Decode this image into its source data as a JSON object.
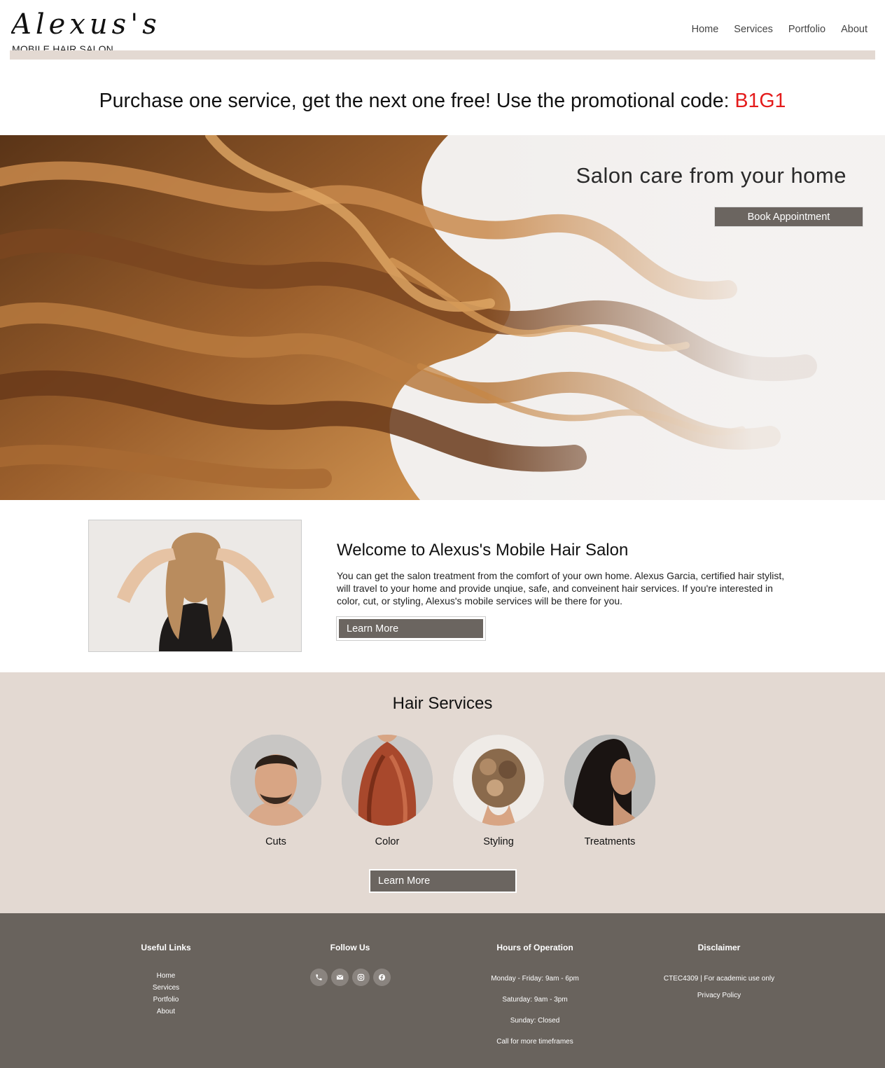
{
  "header": {
    "logo_script": "Alexus's",
    "logo_subtitle": "MOBILE HAIR SALON",
    "nav": [
      "Home",
      "Services",
      "Portfolio",
      "About"
    ]
  },
  "promo": {
    "text": "Purchase one service, get the next one free! Use the promotional code: ",
    "code": "B1G1",
    "code_color": "#e41b1b"
  },
  "hero": {
    "title": "Salon care from your home",
    "button": "Book Appointment"
  },
  "welcome": {
    "title": "Welcome to Alexus's Mobile Hair Salon",
    "body": "You can get the salon treatment from the comfort of your own home. Alexus Garcia, certified hair stylist, will travel to your home and provide unqiue, safe, and conveinent hair services. If you're interested in color, cut, or styling, Alexus's mobile services will be there for you.",
    "button": "Learn More"
  },
  "services": {
    "title": "Hair Services",
    "items": [
      "Cuts",
      "Color",
      "Styling",
      "Treatments"
    ],
    "button": "Learn More",
    "background": "#e3d9d2"
  },
  "footer": {
    "background": "#69635d",
    "useful_links": {
      "title": "Useful Links",
      "items": [
        "Home",
        "Services",
        "Portfolio",
        "About"
      ]
    },
    "follow_us": {
      "title": "Follow Us",
      "icons": [
        "phone-icon",
        "email-icon",
        "instagram-icon",
        "facebook-icon"
      ]
    },
    "hours": {
      "title": "Hours of Operation",
      "lines": [
        "Monday - Friday: 9am - 6pm",
        "Saturday: 9am - 3pm",
        "Sunday: Closed",
        "Call for more timeframes"
      ]
    },
    "disclaimer": {
      "title": "Disclaimer",
      "lines": [
        "CTEC4309 | For academic use only",
        "Privacy Policy"
      ]
    }
  },
  "colors": {
    "button": "#6b6560",
    "accent_beige": "#e3d9d2"
  }
}
